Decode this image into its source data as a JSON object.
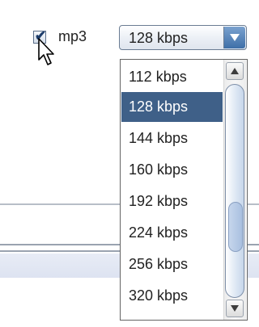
{
  "format_checkbox": {
    "checked": true,
    "label": "mp3",
    "check_glyph": "✔"
  },
  "bitrate_select": {
    "value": "128 kbps"
  },
  "bitrate_dropdown": {
    "options": [
      "112 kbps",
      "128 kbps",
      "144 kbps",
      "160 kbps",
      "192 kbps",
      "224 kbps",
      "256 kbps",
      "320 kbps"
    ],
    "selected_index": 1
  },
  "colors": {
    "selection": "#3f6088",
    "arrow_button": "#3e6fa8"
  }
}
